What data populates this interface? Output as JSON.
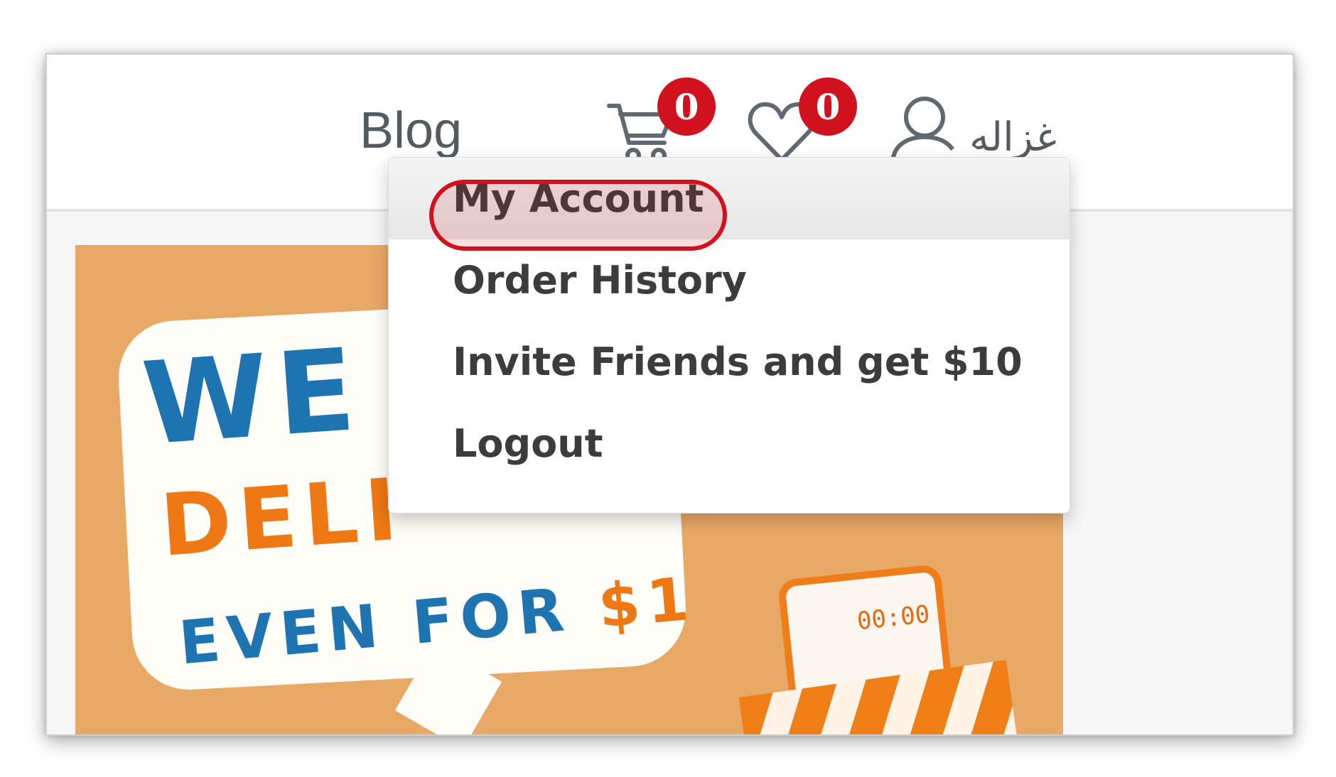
{
  "header": {
    "nav_blog": "Blog",
    "cart_count": "0",
    "wishlist_count": "0",
    "user_name": "غزاله",
    "icons": {
      "cart": "cart-icon",
      "wishlist": "heart-icon",
      "user": "user-icon"
    }
  },
  "banner": {
    "line1": "WE",
    "line2": "DELI",
    "line3_prefix": "EVEN FOR ",
    "line3_price": "$1",
    "timer": "00:00"
  },
  "menu": {
    "items": [
      {
        "label": "My Account",
        "active": true
      },
      {
        "label": "Order History",
        "active": false
      },
      {
        "label": "Invite Friends and get $10",
        "active": false
      },
      {
        "label": "Logout",
        "active": false
      }
    ]
  },
  "colors": {
    "badge": "#d0121f",
    "text": "#3c3c3c",
    "header_text": "#555a60",
    "banner_bg": "#e8a966",
    "promo_blue": "#1e74b1",
    "promo_orange": "#ee7813"
  }
}
